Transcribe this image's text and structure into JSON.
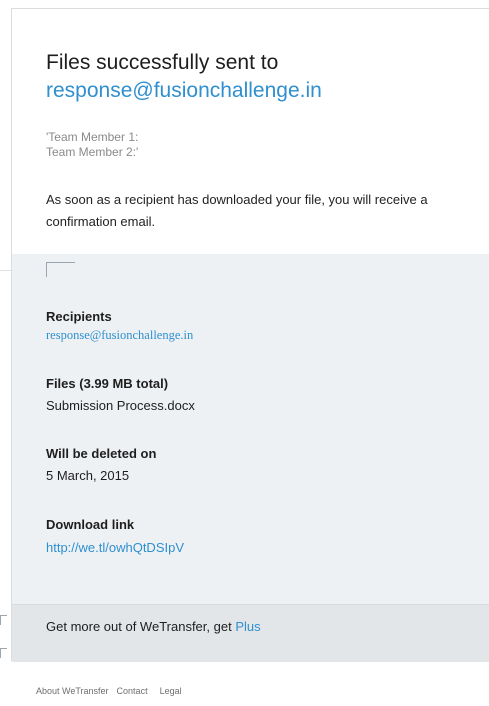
{
  "heading": {
    "line1": "Files successfully sent to",
    "recipient_email": "response@fusionchallenge.in"
  },
  "message": {
    "line1": "'Team Member 1:",
    "line2": "Team Member 2:'"
  },
  "note": "As soon as a recipient has downloaded your file, you will receive a confirmation email.",
  "details": {
    "recipients_label": "Recipients",
    "recipients_value": "response@fusionchallenge.in",
    "files_label": "Files (3.99 MB total)",
    "files_value": "Submission Process.docx",
    "deleted_label": "Will be deleted on",
    "deleted_value": "5 March, 2015",
    "link_label": "Download link",
    "link_value": "http://we.tl/owhQtDSIpV"
  },
  "promo": {
    "text": "Get more out of WeTransfer, get ",
    "link": "Plus"
  },
  "footer": {
    "about": "About WeTransfer",
    "contact": "Contact",
    "legal": "Legal"
  },
  "colors": {
    "accent": "#2f8fcf",
    "details_bg": "#eef1f4",
    "promo_bg": "#e3e6e9"
  }
}
